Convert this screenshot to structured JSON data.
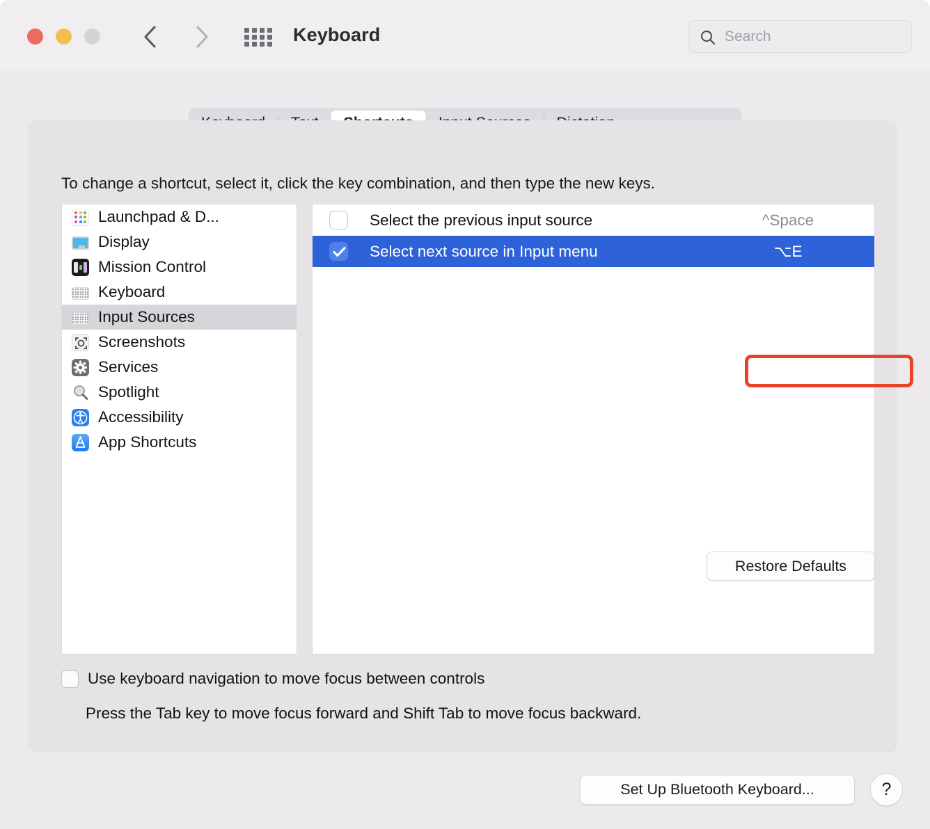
{
  "window": {
    "title": "Keyboard",
    "traffic_lights": [
      {
        "name": "close",
        "color": "#ec6a5e"
      },
      {
        "name": "minimize",
        "color": "#f3bf4f"
      },
      {
        "name": "zoom",
        "color": "#d5d3d6"
      }
    ],
    "back_icon": "chevron-left-icon",
    "forward_icon": "chevron-right-icon",
    "grid_icon": "show-all-preferences-grid-icon",
    "accent_color": "#2e62d8",
    "annotation_color": "#e8432a"
  },
  "search": {
    "placeholder": "Search",
    "value": "",
    "icon": "search-icon"
  },
  "tabs": [
    {
      "label": "Keyboard",
      "selected": false
    },
    {
      "label": "Text",
      "selected": false
    },
    {
      "label": "Shortcuts",
      "selected": true
    },
    {
      "label": "Input Sources",
      "selected": false
    },
    {
      "label": "Dictation",
      "selected": false
    }
  ],
  "main": {
    "hint": "To change a shortcut, select it, click the key combination, and then type the new keys.",
    "categories": [
      {
        "label": "Launchpad & D...",
        "icon": "launchpad-icon",
        "selected": false
      },
      {
        "label": "Display",
        "icon": "display-icon",
        "selected": false
      },
      {
        "label": "Mission Control",
        "icon": "mission-control-icon",
        "selected": false
      },
      {
        "label": "Keyboard",
        "icon": "keyboard-icon",
        "selected": false
      },
      {
        "label": "Input Sources",
        "icon": "input-sources-keyboard-icon",
        "selected": true
      },
      {
        "label": "Screenshots",
        "icon": "screenshots-icon",
        "selected": false
      },
      {
        "label": "Services",
        "icon": "services-gear-icon",
        "selected": false
      },
      {
        "label": "Spotlight",
        "icon": "spotlight-magnifier-icon",
        "selected": false
      },
      {
        "label": "Accessibility",
        "icon": "accessibility-icon",
        "selected": false
      },
      {
        "label": "App Shortcuts",
        "icon": "app-shortcuts-icon",
        "selected": false
      }
    ],
    "shortcuts": [
      {
        "title": "Select the previous input source",
        "keys": "^Space",
        "checked": false,
        "selected": false,
        "highlighted": false
      },
      {
        "title": "Select next source in Input menu",
        "keys": "⌥E",
        "checked": true,
        "selected": true,
        "highlighted": true
      }
    ],
    "restore_defaults_label": "Restore Defaults",
    "keyboard_nav": {
      "label": "Use keyboard navigation to move focus between controls",
      "checked": false,
      "sublabel": "Press the Tab key to move focus forward and Shift Tab to move focus backward."
    }
  },
  "footer": {
    "setup_bluetooth_label": "Set Up Bluetooth Keyboard...",
    "help_label": "?"
  }
}
